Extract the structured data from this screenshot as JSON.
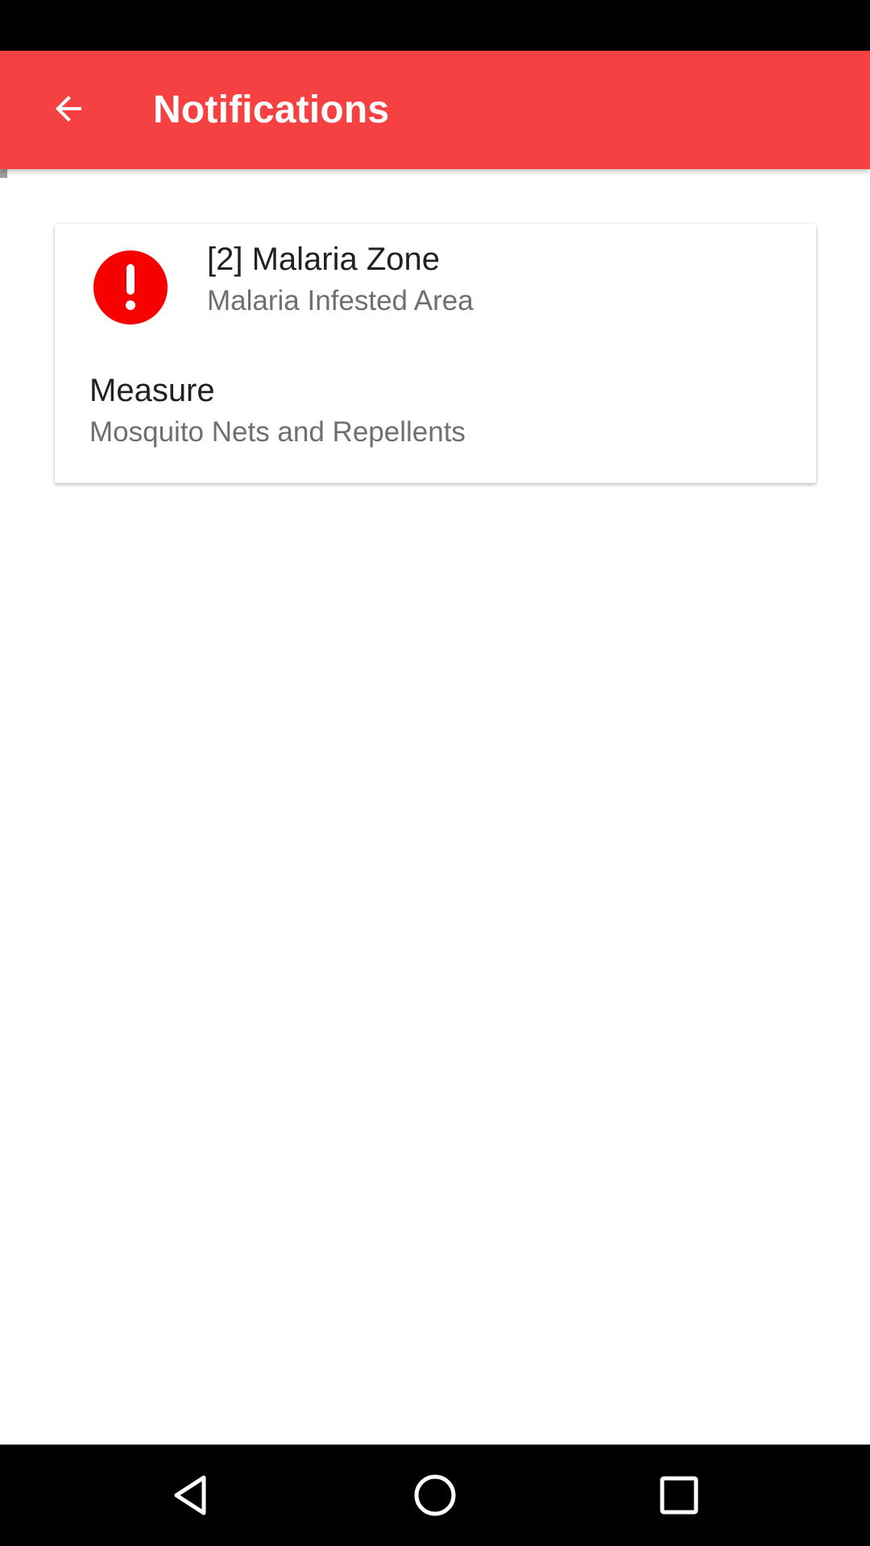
{
  "app_bar": {
    "title": "Notifications",
    "back_icon": "arrow-left-icon",
    "color": "#f64142"
  },
  "notification": {
    "icon": "exclamation-circle-icon",
    "icon_color": "#f70000",
    "title": "[2] Malaria Zone",
    "subtitle": "Malaria Infested Area",
    "measure_label": "Measure",
    "measure_value": "Mosquito Nets and Repellents"
  },
  "nav_bar": {
    "back_icon": "triangle-back-icon",
    "home_icon": "circle-home-icon",
    "recents_icon": "square-recents-icon"
  }
}
